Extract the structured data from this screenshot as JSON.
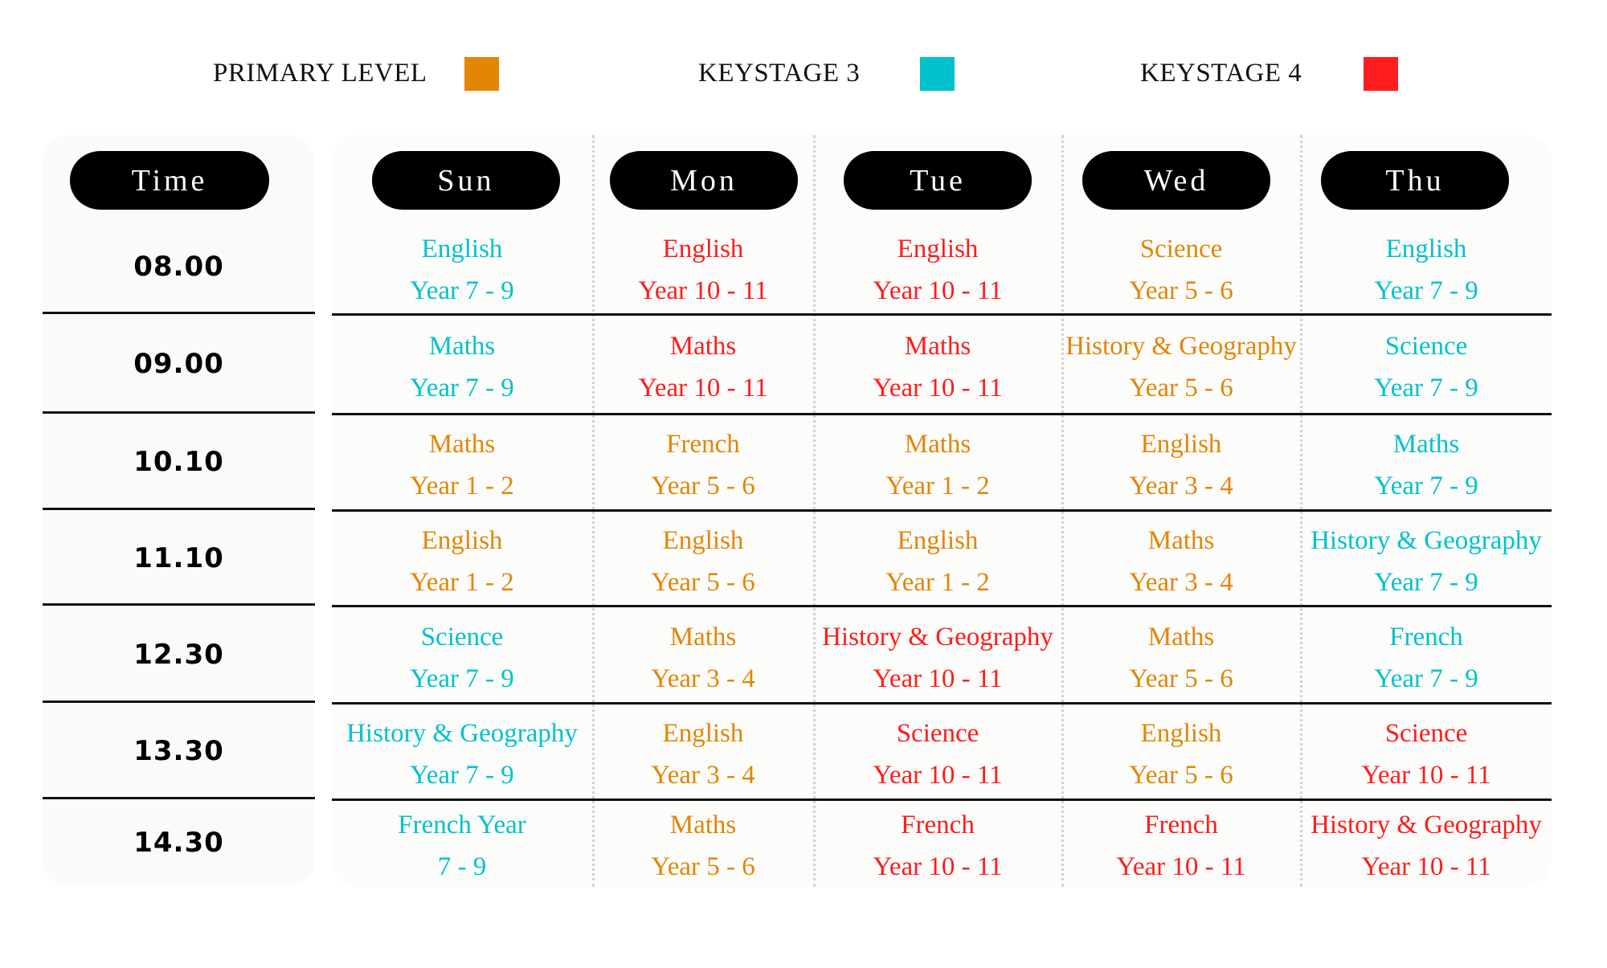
{
  "legend": [
    {
      "label": "PRIMARY LEVEL",
      "color": "#E38505"
    },
    {
      "label": "KEYSTAGE 3",
      "color": "#00C2CC"
    },
    {
      "label": "KEYSTAGE 4",
      "color": "#FF1C1C"
    }
  ],
  "levels": {
    "primary": "#E38505",
    "ks3": "#00C2CC",
    "ks4": "#FF1C1C"
  },
  "headers": {
    "time": "Time",
    "days": [
      "Sun",
      "Mon",
      "Tue",
      "Wed",
      "Thu"
    ]
  },
  "rows": [
    {
      "time": "08.00",
      "cells": [
        {
          "subject": "English",
          "year": "Year 7 - 9",
          "level": "ks3"
        },
        {
          "subject": "English",
          "year": "Year 10 - 11",
          "level": "ks4"
        },
        {
          "subject": "English",
          "year": "Year 10 - 11",
          "level": "ks4"
        },
        {
          "subject": "Science",
          "year": "Year 5 - 6",
          "level": "primary"
        },
        {
          "subject": "English",
          "year": "Year 7 - 9",
          "level": "ks3"
        }
      ]
    },
    {
      "time": "09.00",
      "cells": [
        {
          "subject": "Maths",
          "year": "Year 7 - 9",
          "level": "ks3"
        },
        {
          "subject": "Maths",
          "year": "Year 10 - 11",
          "level": "ks4"
        },
        {
          "subject": "Maths",
          "year": "Year 10 - 11",
          "level": "ks4"
        },
        {
          "subject": "History & Geography",
          "year": "Year 5 - 6",
          "level": "primary"
        },
        {
          "subject": "Science",
          "year": "Year 7 - 9",
          "level": "ks3"
        }
      ]
    },
    {
      "time": "10.10",
      "cells": [
        {
          "subject": "Maths",
          "year": "Year 1 - 2",
          "level": "primary"
        },
        {
          "subject": "French",
          "year": "Year 5 - 6",
          "level": "primary"
        },
        {
          "subject": "Maths",
          "year": "Year 1 - 2",
          "level": "primary"
        },
        {
          "subject": "English",
          "year": "Year 3 - 4",
          "level": "primary"
        },
        {
          "subject": "Maths",
          "year": "Year 7 - 9",
          "level": "ks3"
        }
      ]
    },
    {
      "time": "11.10",
      "cells": [
        {
          "subject": "English",
          "year": "Year 1 - 2",
          "level": "primary"
        },
        {
          "subject": "English",
          "year": "Year 5 - 6",
          "level": "primary"
        },
        {
          "subject": "English",
          "year": "Year 1 - 2",
          "level": "primary"
        },
        {
          "subject": "Maths",
          "year": "Year 3 - 4",
          "level": "primary"
        },
        {
          "subject": "History & Geography",
          "year": "Year 7 - 9",
          "level": "ks3"
        }
      ]
    },
    {
      "time": "12.30",
      "cells": [
        {
          "subject": "Science",
          "year": "Year 7 - 9",
          "level": "ks3"
        },
        {
          "subject": "Maths",
          "year": "Year 3 - 4",
          "level": "primary"
        },
        {
          "subject": "History & Geography",
          "year": "Year 10 - 11",
          "level": "ks4"
        },
        {
          "subject": "Maths",
          "year": "Year 5 - 6",
          "level": "primary"
        },
        {
          "subject": "French",
          "year": "Year 7 - 9",
          "level": "ks3"
        }
      ]
    },
    {
      "time": "13.30",
      "cells": [
        {
          "subject": "History & Geography",
          "year": "Year 7 - 9",
          "level": "ks3"
        },
        {
          "subject": "English",
          "year": "Year 3 - 4",
          "level": "primary"
        },
        {
          "subject": "Science",
          "year": "Year 10 - 11",
          "level": "ks4"
        },
        {
          "subject": "English",
          "year": "Year 5 - 6",
          "level": "primary"
        },
        {
          "subject": "Science",
          "year": "Year 10 - 11",
          "level": "ks4"
        }
      ]
    },
    {
      "time": "14.30",
      "cells": [
        {
          "subject": "French Year",
          "year": "7 - 9",
          "level": "ks3"
        },
        {
          "subject": "Maths",
          "year": "Year 5 - 6",
          "level": "primary"
        },
        {
          "subject": "French",
          "year": "Year 10 - 11",
          "level": "ks4"
        },
        {
          "subject": "French",
          "year": "Year 10 - 11",
          "level": "ks4"
        },
        {
          "subject": "History & Geography",
          "year": "Year 10 - 11",
          "level": "ks4"
        }
      ]
    }
  ]
}
